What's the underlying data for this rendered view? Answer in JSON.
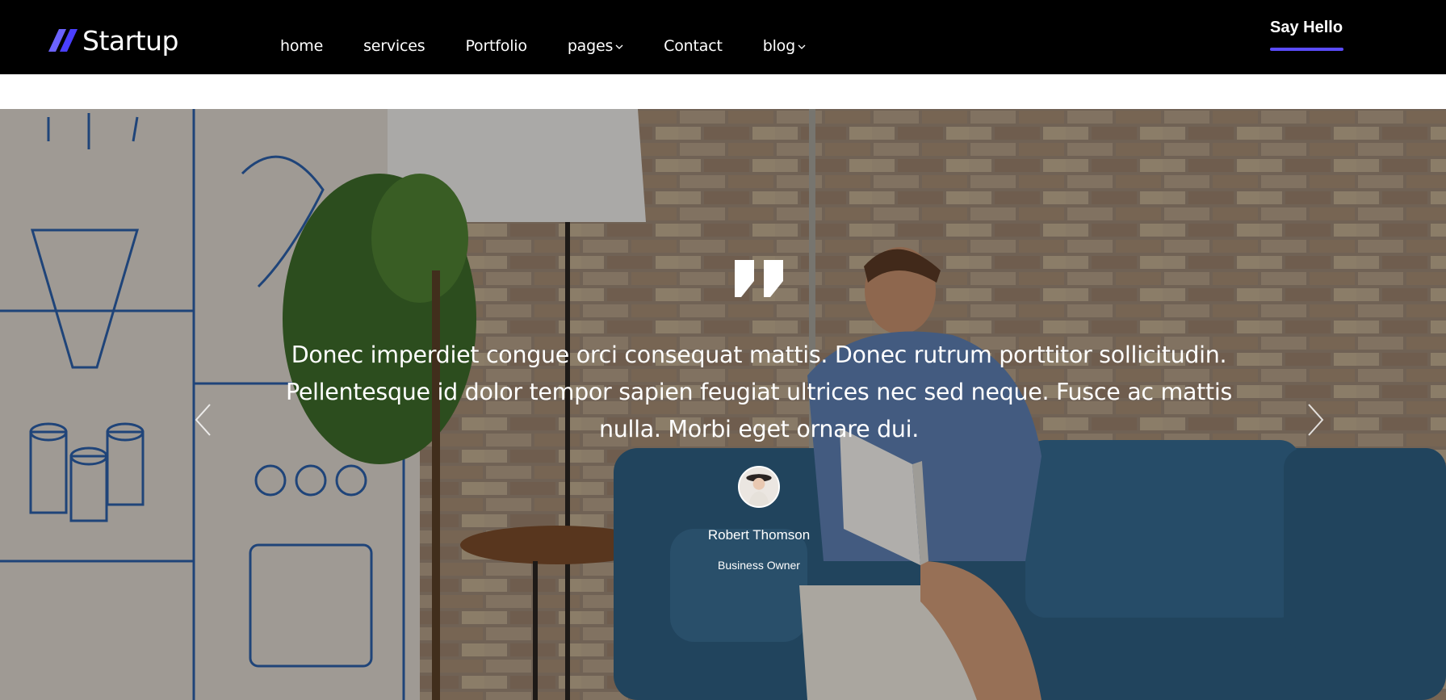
{
  "header": {
    "logo_text": "Startup",
    "logo_icon": "slash-logo-icon",
    "nav": [
      {
        "label": "home",
        "dropdown": false
      },
      {
        "label": "services",
        "dropdown": false
      },
      {
        "label": "Portfolio",
        "dropdown": false
      },
      {
        "label": "pages",
        "dropdown": true
      },
      {
        "label": "Contact",
        "dropdown": false
      },
      {
        "label": "blog",
        "dropdown": true
      }
    ],
    "cta_label": "Say Hello"
  },
  "hero": {
    "quote_icon": "quote-icon",
    "quote": "Donec imperdiet congue orci consequat mattis. Donec rutrum porttitor sollicitudin. Pellentesque id dolor tempor sapien feugiat ultrices nec sed neque. Fusce ac mattis nulla. Morbi eget ornare dui.",
    "author_name": "Robert Thomson",
    "author_role": "Business Owner",
    "prev_icon": "chevron-left-icon",
    "next_icon": "chevron-right-icon"
  },
  "colors": {
    "header_bg": "#000000",
    "accent": "#5b4cff",
    "text_light": "#ffffff"
  }
}
